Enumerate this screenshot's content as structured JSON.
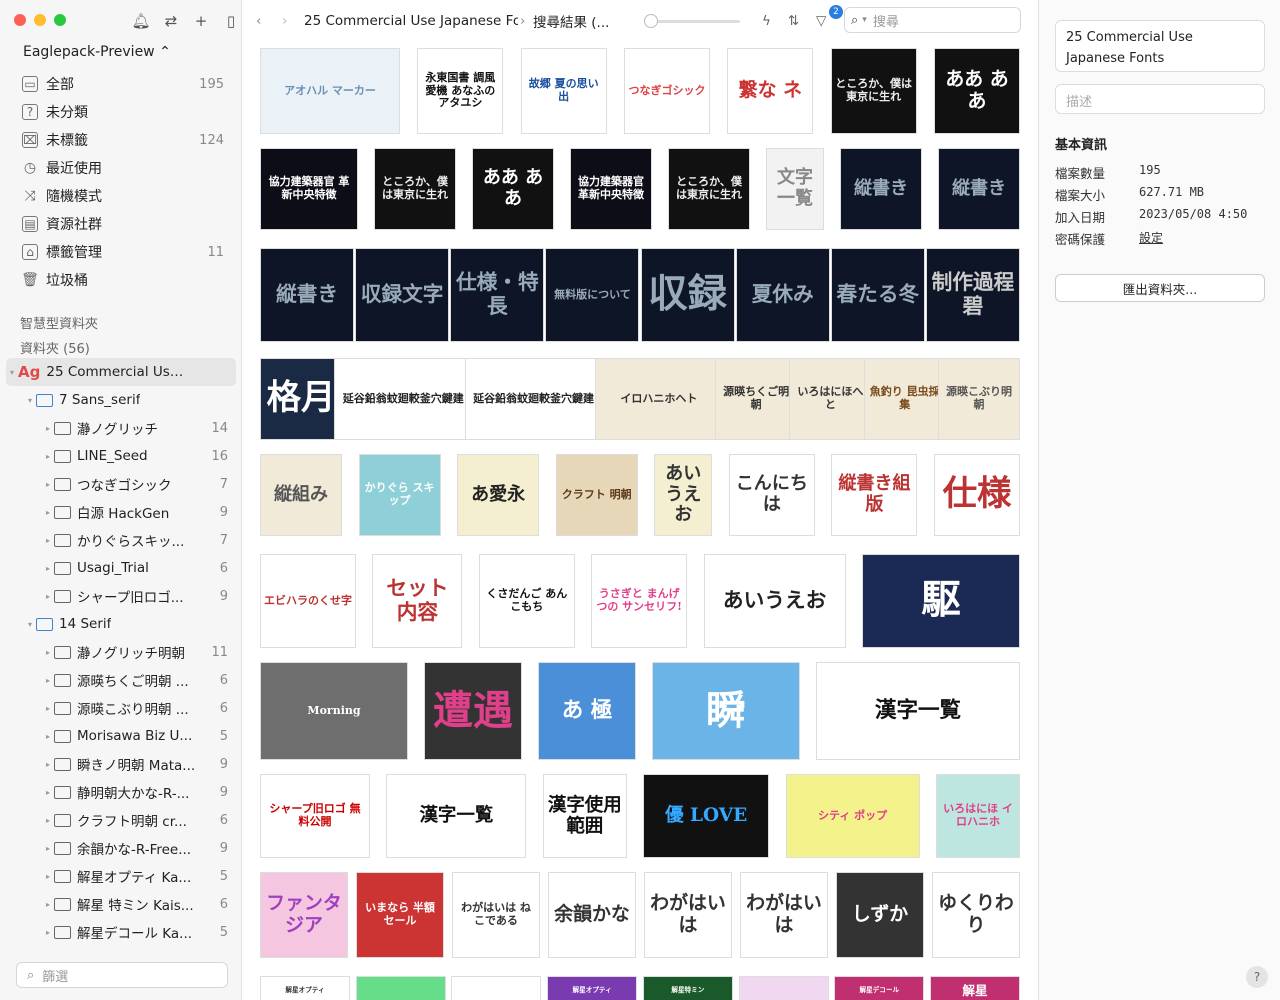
{
  "sidebar": {
    "library_name": "Eaglepack-Preview ⌃",
    "nav": [
      {
        "label": "全部",
        "count": "195",
        "icon": "all-items-icon"
      },
      {
        "label": "未分類",
        "count": "",
        "icon": "uncategorized-icon"
      },
      {
        "label": "未標籤",
        "count": "124",
        "icon": "untagged-icon"
      },
      {
        "label": "最近使用",
        "count": "",
        "icon": "clock-icon"
      },
      {
        "label": "隨機模式",
        "count": "",
        "icon": "shuffle-icon"
      },
      {
        "label": "資源社群",
        "count": "",
        "icon": "community-icon"
      },
      {
        "label": "標籤管理",
        "count": "11",
        "icon": "tag-icon"
      },
      {
        "label": "垃圾桶",
        "count": "",
        "icon": "trash-icon"
      }
    ],
    "smart_folders_label": "智慧型資料夾",
    "folders_label": "資料夾 (56)",
    "tree": [
      {
        "label": "25 Commercial Use Ja...",
        "count": "",
        "level": 0,
        "type": "ag",
        "selected": true,
        "expanded": true
      },
      {
        "label": "7 Sans_serif",
        "count": "",
        "level": 1,
        "type": "blue",
        "expanded": true
      },
      {
        "label": "瀞ノグリッチ",
        "count": "14",
        "level": 2
      },
      {
        "label": "LINE_Seed",
        "count": "16",
        "level": 2
      },
      {
        "label": "つなぎゴシック",
        "count": "7",
        "level": 2
      },
      {
        "label": "白源 HackGen",
        "count": "9",
        "level": 2
      },
      {
        "label": "かりぐらスキッ...",
        "count": "7",
        "level": 2
      },
      {
        "label": "Usagi_Trial",
        "count": "6",
        "level": 2
      },
      {
        "label": "シャープ旧ロゴ...",
        "count": "9",
        "level": 2
      },
      {
        "label": "14 Serif",
        "count": "",
        "level": 1,
        "type": "blue",
        "expanded": true
      },
      {
        "label": "瀞ノグリッチ明朝",
        "count": "11",
        "level": 2
      },
      {
        "label": "源暎ちくご明朝 ...",
        "count": "6",
        "level": 2
      },
      {
        "label": "源暎こぶり明朝 ...",
        "count": "6",
        "level": 2
      },
      {
        "label": "Morisawa Biz U...",
        "count": "5",
        "level": 2
      },
      {
        "label": "瞬きノ明朝 Mata...",
        "count": "9",
        "level": 2
      },
      {
        "label": "静明朝大かな-R-...",
        "count": "9",
        "level": 2
      },
      {
        "label": "クラフト明朝 cr...",
        "count": "6",
        "level": 2
      },
      {
        "label": "余韻かな-R-Free...",
        "count": "9",
        "level": 2
      },
      {
        "label": "解星オプティ Ka...",
        "count": "5",
        "level": 2
      },
      {
        "label": "解星 特ミン Kais...",
        "count": "6",
        "level": 2
      },
      {
        "label": "解星デコール Ka...",
        "count": "5",
        "level": 2
      }
    ],
    "filter_placeholder": "篩選"
  },
  "topbar": {
    "breadcrumb_folder": "25 Commercial Use Japanese Fo...",
    "breadcrumb_current": "搜尋結果 (...",
    "filter_badge": "2",
    "search_placeholder": "搜尋"
  },
  "thumbs": [
    [
      "アオハル マーカー",
      "#eaf2f8",
      "#6a8fb3"
    ],
    [
      "永東国書 調風愛機 あなふの アタユシ",
      "#ffffff",
      "#111"
    ],
    [
      "故郷 夏の思い出",
      "#ffffff",
      "#1a4fa0"
    ],
    [
      "つなぎゴシック",
      "#ffffff",
      "#d44"
    ],
    [
      "繋な ネ",
      "#ffffff",
      "#c33"
    ],
    [
      "ところか、僕は東京に生れ",
      "#111",
      "#eee"
    ],
    [
      "ああ ああ",
      "#111",
      "#fff"
    ],
    [
      "協力建築器官 革新中央特徴",
      "#0d0d18",
      "#fff"
    ],
    [
      "ところか、僕は東京に生れ",
      "#111",
      "#eee"
    ],
    [
      "ああ ああ",
      "#111",
      "#fff"
    ],
    [
      "協力建築器官 革新中央特徴",
      "#0d0d18",
      "#fff"
    ],
    [
      "ところか、僕は東京に生れ",
      "#111",
      "#eee"
    ],
    [
      "文字一覧",
      "#f2f2f2",
      "#888"
    ],
    [
      "縦書き",
      "#0d1526",
      "#9ab"
    ],
    [
      "縦書き",
      "#0d1526",
      "#9ab"
    ],
    [
      "縦書き",
      "#0d1526",
      "#9ab"
    ],
    [
      "収録文字",
      "#0d1526",
      "#9ab"
    ],
    [
      "仕様・特長",
      "#0d1526",
      "#9ab"
    ],
    [
      "無料版について",
      "#0d1526",
      "#9ab"
    ],
    [
      "収録",
      "#0d1526",
      "#9ab"
    ],
    [
      "夏休み",
      "#0d1526",
      "#9ab"
    ],
    [
      "春たる冬",
      "#0d1526",
      "#9ab"
    ],
    [
      "制作過程 碧",
      "#0d1526",
      "#ccc"
    ],
    [
      "格月",
      "#1b2a44",
      "#fff"
    ],
    [
      "延谷鉛翁蚊廻較釜穴鍵建",
      "#fff",
      "#222"
    ],
    [
      "延谷鉛翁蚊廻較釜穴鍵建",
      "#fff",
      "#222"
    ],
    [
      "イロハニホヘト",
      "#f1ead8",
      "#333"
    ],
    [
      "源暎ちくご明朝",
      "#f1ead8",
      "#333"
    ],
    [
      "いろはにほへと",
      "#f1ead8",
      "#333"
    ],
    [
      "魚釣り 昆虫採集",
      "#f1ead8",
      "#7a4a1a"
    ],
    [
      "源暎こぶり明朝",
      "#f1ead8",
      "#555"
    ],
    [
      "縦組み",
      "#f1ead8",
      "#555"
    ],
    [
      "かりぐら スキップ",
      "#8fd0d8",
      "#fff"
    ],
    [
      "あ愛永",
      "#f5efd2",
      "#222"
    ],
    [
      "クラフト 明朝",
      "#e6d7b8",
      "#5a3a1a"
    ],
    [
      "あいうえお",
      "#f5efd2",
      "#333"
    ],
    [
      "こんにちは",
      "#fff",
      "#333"
    ],
    [
      "縦書き組版",
      "#fff",
      "#b33"
    ],
    [
      "仕様",
      "#fff",
      "#b33"
    ],
    [
      "エビハラのくせ字",
      "#fff",
      "#b33"
    ],
    [
      "セット内容",
      "#fff",
      "#b33"
    ],
    [
      "くさだんご あんこもち",
      "#fff",
      "#111"
    ],
    [
      "うさぎと まんげつの サンセリフ!",
      "#fff",
      "#e0408a"
    ],
    [
      "あいうえお",
      "#fff",
      "#222"
    ],
    [
      "駆",
      "#1b2a55",
      "#fff"
    ],
    [
      "Morning",
      "#6e6e6e",
      "#fff"
    ],
    [
      "遭遇",
      "#333",
      "#e0408a"
    ],
    [
      "あ 極",
      "#4a8fd8",
      "#fff"
    ],
    [
      "瞬",
      "#6ab4e8",
      "#fff"
    ],
    [
      "漢字一覧",
      "#fff",
      "#111"
    ],
    [
      "シャープ旧ロゴ 無料公開",
      "#fff",
      "#c00"
    ],
    [
      "漢字一覧",
      "#fff",
      "#111"
    ],
    [
      "漢字使用範囲",
      "#fff",
      "#111"
    ],
    [
      "優 LOVE",
      "#111",
      "#3af"
    ],
    [
      "シティ ポップ",
      "#f4f28a",
      "#e0408a"
    ],
    [
      "いろはにほ イロハニホ",
      "#bde6e0",
      "#e0408a"
    ],
    [
      "ファンタジア",
      "#f4c6e0",
      "#a040c0"
    ],
    [
      "いまなら 半額セール",
      "#c33",
      "#fff"
    ],
    [
      "わがはいは ねこである",
      "#fff",
      "#333"
    ],
    [
      "余韻かな",
      "#fff",
      "#333"
    ],
    [
      "わがはいは",
      "#fff",
      "#333"
    ],
    [
      "わがはいは",
      "#fff",
      "#333"
    ],
    [
      "しずか",
      "#333",
      "#fff"
    ],
    [
      "ゆくりわり",
      "#fff",
      "#333"
    ],
    [
      "解星オプティ",
      "#fff",
      "#333"
    ],
    [
      "",
      "#6d8",
      "#fff"
    ],
    [
      "",
      "#fff",
      "#333"
    ],
    [
      "解星オプティ",
      "#7a3ab0",
      "#fff"
    ],
    [
      "解星特ミン",
      "#1a5a2a",
      "#fff"
    ],
    [
      "",
      "#f0d8f0",
      "#333"
    ],
    [
      "解星デコール",
      "#c03070",
      "#fff"
    ],
    [
      "解星",
      "#c03070",
      "#fff"
    ],
    [
      "",
      "#fff",
      "#333"
    ]
  ],
  "info": {
    "title": "25 Commercial Use Japanese Fonts",
    "description_placeholder": "描述",
    "section_label": "基本資訊",
    "rows": [
      {
        "key": "檔案數量",
        "value": "195"
      },
      {
        "key": "檔案大小",
        "value": "627.71 MB"
      },
      {
        "key": "加入日期",
        "value": "2023/05/08 4:50"
      },
      {
        "key": "密碼保護",
        "value": "設定"
      }
    ],
    "export_button": "匯出資料夾..."
  },
  "colors": {
    "accent": "#2a7de1",
    "folder_blue": "#3a86d6",
    "ag_red": "#e04a4a"
  }
}
